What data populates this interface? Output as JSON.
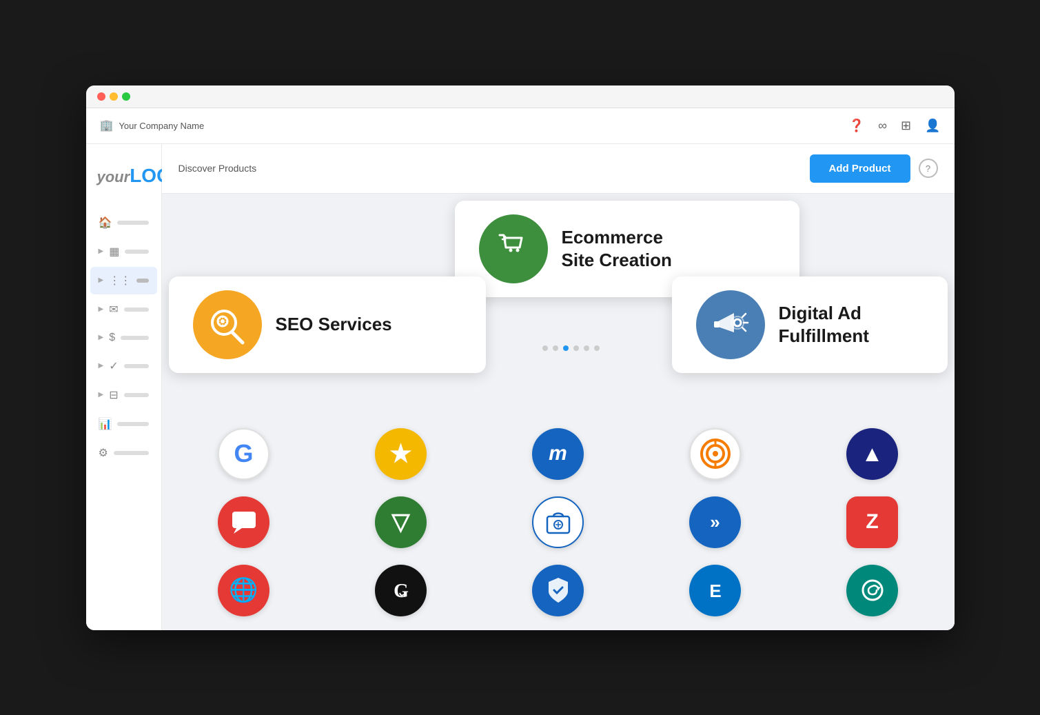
{
  "browser": {
    "dots": [
      "red",
      "yellow",
      "green"
    ]
  },
  "appHeader": {
    "companyName": "Your Company Name",
    "icons": [
      "help",
      "infinity",
      "grid",
      "user"
    ]
  },
  "logo": {
    "your": "your",
    "logo": "LOGO"
  },
  "sidebar": {
    "items": [
      {
        "icon": "🏠",
        "label": "Home",
        "active": false
      },
      {
        "icon": "▦",
        "label": "Grid1",
        "active": false
      },
      {
        "icon": "⋮⋮⋮",
        "label": "Apps",
        "active": true
      },
      {
        "icon": "✉",
        "label": "Mail",
        "active": false
      },
      {
        "icon": "$",
        "label": "Billing",
        "active": false
      },
      {
        "icon": "✓",
        "label": "Tasks",
        "active": false
      },
      {
        "icon": "⬛",
        "label": "Reports",
        "active": false
      },
      {
        "icon": "📊",
        "label": "Analytics",
        "active": false
      },
      {
        "icon": "⚙",
        "label": "Settings",
        "active": false
      }
    ]
  },
  "contentHeader": {
    "discoverLabel": "Discover Products",
    "addProductLabel": "Add Product",
    "helpLabel": "?"
  },
  "cards": {
    "ecommerce": {
      "title": "Ecommerce\nSite Creation",
      "iconColor": "#3d8f3d",
      "iconBg": "#3d8f3d"
    },
    "seo": {
      "title": "SEO Services",
      "iconColor": "#f5a623",
      "iconBg": "#f5a623"
    },
    "digitalAd": {
      "title": "Digital Ad\nFulfillment",
      "iconColor": "#4a7fb5",
      "iconBg": "#4a7fb5"
    }
  },
  "carouselDots": [
    {
      "active": false
    },
    {
      "active": false
    },
    {
      "active": true
    },
    {
      "active": false
    },
    {
      "active": false
    },
    {
      "active": false
    }
  ],
  "productIcons": [
    {
      "id": "google",
      "letter": "G",
      "bg": "#fff",
      "textColor": "#4285F4",
      "border": "#e0e0e0",
      "row": 1
    },
    {
      "id": "star",
      "letter": "★",
      "bg": "#f5b800",
      "textColor": "#fff",
      "row": 1
    },
    {
      "id": "m-blue",
      "letter": "m",
      "bg": "#1565C0",
      "textColor": "#fff",
      "row": 1
    },
    {
      "id": "target-circle",
      "letter": "◎",
      "bg": "#fff",
      "textColor": "#f57c00",
      "border": "#e0e0e0",
      "row": 1
    },
    {
      "id": "sailthru",
      "letter": "▲",
      "bg": "#1a237e",
      "textColor": "#fff",
      "row": 1
    },
    {
      "id": "chat-red",
      "letter": "💬",
      "bg": "#e53935",
      "textColor": "#fff",
      "row": 2
    },
    {
      "id": "v-green",
      "letter": "▽",
      "bg": "#2e7d32",
      "textColor": "#fff",
      "row": 2
    },
    {
      "id": "shopify",
      "letter": "🛍",
      "bg": "#fff",
      "textColor": "#1565C0",
      "border": "#1565C0",
      "row": 2
    },
    {
      "id": "prompt",
      "letter": "»",
      "bg": "#1565C0",
      "textColor": "#fff",
      "row": 2
    },
    {
      "id": "z-red",
      "letter": "Z",
      "bg": "#e53935",
      "textColor": "#fff",
      "row": 2
    },
    {
      "id": "globe-red",
      "letter": "🌐",
      "bg": "#e53935",
      "textColor": "#fff",
      "row": 3
    },
    {
      "id": "godaddy",
      "letter": "G̃",
      "bg": "#111",
      "textColor": "#fff",
      "row": 3
    },
    {
      "id": "shield-blue",
      "letter": "🛡",
      "bg": "#1565C0",
      "textColor": "#fff",
      "row": 3
    },
    {
      "id": "exchange",
      "letter": "⬡",
      "bg": "#0072C6",
      "textColor": "#fff",
      "row": 3
    },
    {
      "id": "zing",
      "letter": "↩",
      "bg": "#00897B",
      "textColor": "#fff",
      "row": 3
    }
  ]
}
